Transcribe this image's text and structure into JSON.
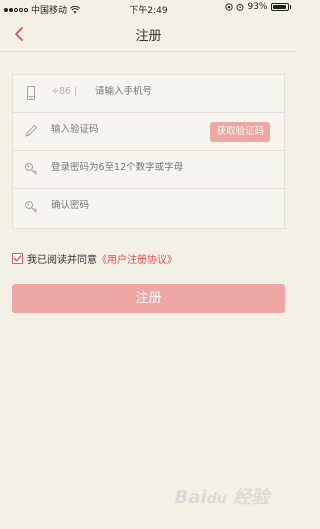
{
  "status_bar": {
    "carrier": "中国移动",
    "time": "下午2:49",
    "battery": "93%",
    "battery_level": 0.93,
    "signal_bars_filled": 2,
    "signal_bars_total": 5
  },
  "nav": {
    "title": "注册"
  },
  "form": {
    "phone_prefix": "+86 |",
    "phone_placeholder": "请输入手机号",
    "code_placeholder": "输入验证码",
    "code_button": "获取验证码",
    "password_placeholder": "登录密码为6至12个数字或字母",
    "confirm_placeholder": "确认密码"
  },
  "agreement": {
    "checked": true,
    "text": "我已阅读并同意",
    "link": "《用户注册协议》"
  },
  "submit_label": "注册",
  "watermark": "Baidu经验",
  "colors": {
    "accent": "#e05050",
    "button": "#efa7a5",
    "background": "#f3f0e6"
  }
}
